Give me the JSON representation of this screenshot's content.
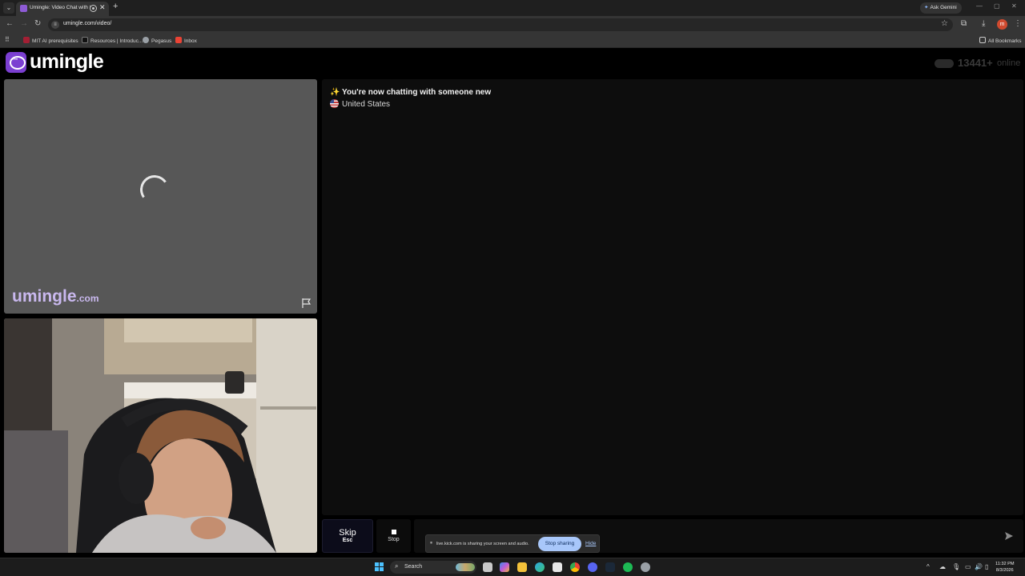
{
  "browser": {
    "tab_title": "Umingle: Video Chat with S",
    "tab_close": "✕",
    "new_tab": "+",
    "ask_gemini": "Ask Gemini",
    "url": "umingle.com/video/",
    "bookmarks": [
      {
        "label": "MIT AI prerequisites",
        "icon": "bookmark-mit-icon",
        "color": "#a31f34"
      },
      {
        "label": "Resources | Introduc...",
        "icon": "bookmark-resources-icon",
        "color": "#111111"
      },
      {
        "label": "Pegasus",
        "icon": "bookmark-pegasus-icon",
        "color": "#9aa0a6"
      },
      {
        "label": "Inbox",
        "icon": "gmail-icon",
        "color": "#ea4335"
      }
    ],
    "all_bookmarks": "All Bookmarks",
    "profile_initial": "m"
  },
  "site": {
    "logo_text": "umingle",
    "online_count": "13441+",
    "online_label": "online",
    "watermark_name": "umingle",
    "watermark_domain": ".com",
    "brand_color": "#7b3fd1"
  },
  "chat": {
    "system_message": "✨ You're now chatting with someone new",
    "country": "United States",
    "input_placeholder": ""
  },
  "controls": {
    "skip_label": "Skip",
    "skip_key": "Esc",
    "stop_label": "Stop"
  },
  "share_bar": {
    "message": "live.kick.com is sharing your screen and audio.",
    "stop_sharing": "Stop sharing",
    "hide": "Hide"
  },
  "taskbar": {
    "search_label": "Search",
    "time": "11:32 PM",
    "date": "8/3/2026"
  }
}
